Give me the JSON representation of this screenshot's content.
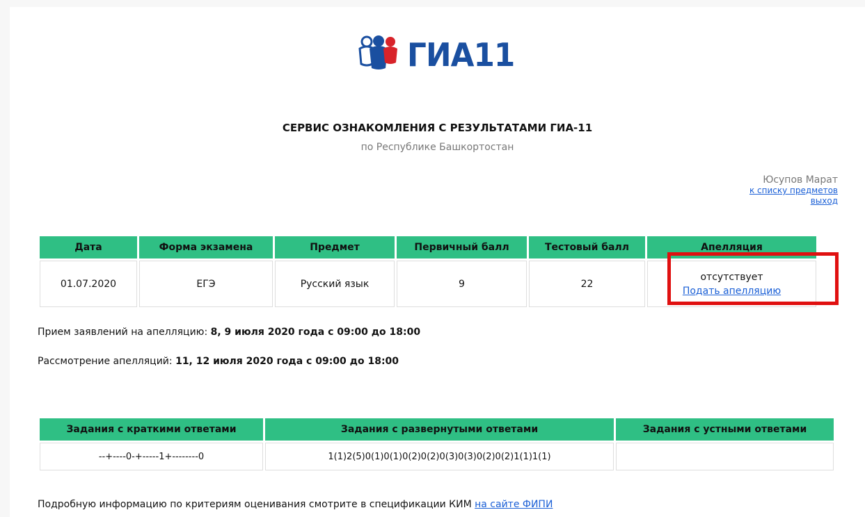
{
  "logo": {
    "text": "ГИА11",
    "icon": "people-logo-icon"
  },
  "header": {
    "title": "СЕРВИС ОЗНАКОМЛЕНИЯ С РЕЗУЛЬТАТАМИ ГИА-11",
    "subtitle": "по Республике Башкортостан"
  },
  "user": {
    "name": "Юсупов Марат",
    "subjects_link": "к списку предметов",
    "logout_link": "выход"
  },
  "results": {
    "headers": [
      "Дата",
      "Форма экзамена",
      "Предмет",
      "Первичный балл",
      "Тестовый балл",
      "Апелляция"
    ],
    "row": {
      "date": "01.07.2020",
      "form": "ЕГЭ",
      "subject": "Русский язык",
      "primary_score": "9",
      "test_score": "22",
      "appeal_status": "отсутствует",
      "appeal_link": "Подать апелляцию"
    }
  },
  "appeal_info": {
    "reception_label": "Прием заявлений на апелляцию: ",
    "reception_value": "8, 9 июля 2020 года с 09:00 до 18:00",
    "review_label": "Рассмотрение апелляций: ",
    "review_value": "11, 12 июля 2020 года с 09:00 до 18:00"
  },
  "tasks": {
    "headers": [
      "Задания с краткими ответами",
      "Задания с развернутыми ответами",
      "Задания с устными ответами"
    ],
    "row": {
      "short": "--+----0-+-----1+--------0",
      "extended": "1(1)2(5)0(1)0(1)0(2)0(2)0(3)0(3)0(2)0(2)1(1)1(1)",
      "oral": ""
    }
  },
  "footer": {
    "text": "Подробную информацию по критериям оценивания смотрите в спецификации КИМ ",
    "link": "на сайте ФИПИ"
  },
  "colors": {
    "header_green": "#2fbf84",
    "link_blue": "#1a5fd6",
    "logo_blue": "#1a4fa0",
    "highlight_red": "#e01010"
  }
}
